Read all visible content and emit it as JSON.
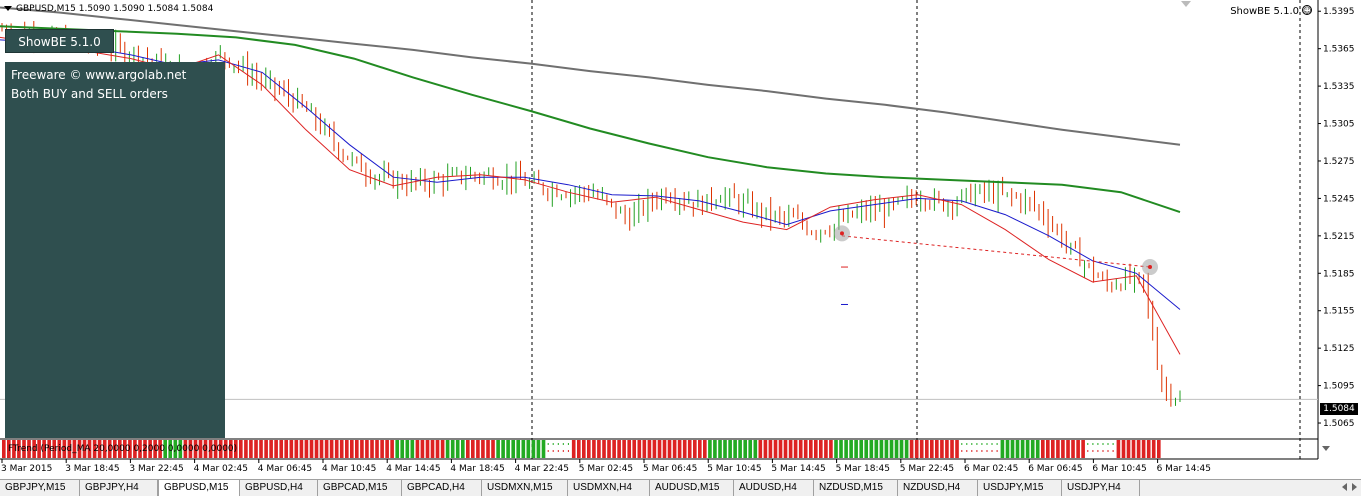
{
  "window": {
    "symbol_line": "GBPUSD,M15  1.5090 1.5090 1.5084 1.5084",
    "showbe_right": "ShowBE 5.1.0",
    "smiley_glyph": "☺",
    "current_price": "1.5084"
  },
  "showbe": {
    "button_label": "ShowBE 5.1.0",
    "freeware": "Freeware © www.argolab.net",
    "orders": "Both BUY and SELL orders"
  },
  "indicator": {
    "label": "FTrend (Period_MA 20,0000 0,2000 0,0000 0,0000)"
  },
  "chart_data": {
    "type": "candlestick",
    "symbol": "GBPUSD",
    "timeframe": "M15",
    "y_ticks": [
      "1.5395",
      "1.5365",
      "1.5335",
      "1.5305",
      "1.5275",
      "1.5245",
      "1.5215",
      "1.5185",
      "1.5155",
      "1.5125",
      "1.5095",
      "1.5065"
    ],
    "ylim": [
      1.5053,
      1.5404
    ],
    "x_ticks": [
      "3 Mar 2015",
      "3 Mar 18:45",
      "3 Mar 22:45",
      "4 Mar 02:45",
      "4 Mar 06:45",
      "4 Mar 10:45",
      "4 Mar 14:45",
      "4 Mar 18:45",
      "4 Mar 22:45",
      "5 Mar 02:45",
      "5 Mar 06:45",
      "5 Mar 10:45",
      "5 Mar 14:45",
      "5 Mar 18:45",
      "5 Mar 22:45",
      "6 Mar 02:45",
      "6 Mar 06:45",
      "6 Mar 10:45",
      "6 Mar 14:45"
    ],
    "session_separators": [
      "4 Mar 2015",
      "5 Mar 2015",
      "6 Mar 2015"
    ],
    "close_profile": [
      1.538,
      1.5378,
      1.5376,
      1.5372,
      1.537,
      1.5368,
      1.5366,
      1.5362,
      1.5356,
      1.535,
      1.5347,
      1.5352,
      1.536,
      1.535,
      1.534,
      1.5332,
      1.5322,
      1.5308,
      1.529,
      1.5275,
      1.5265,
      1.526,
      1.5257,
      1.5258,
      1.526,
      1.5263,
      1.5264,
      1.5262,
      1.526,
      1.5255,
      1.5252,
      1.525,
      1.525,
      1.524,
      1.5228,
      1.524,
      1.525,
      1.5245,
      1.524,
      1.5248,
      1.5242,
      1.5235,
      1.523,
      1.5228,
      1.522,
      1.5222,
      1.523,
      1.5235,
      1.5236,
      1.5242,
      1.5248,
      1.524,
      1.5245,
      1.525,
      1.5248,
      1.5246,
      1.524,
      1.5225,
      1.5205,
      1.519,
      1.5175,
      1.518,
      1.5178,
      1.5095,
      1.5084
    ],
    "series": [
      {
        "name": "MA slow",
        "color": "#707070",
        "values": [
          1.5398,
          1.5394,
          1.5389,
          1.5384,
          1.5379,
          1.5374,
          1.5369,
          1.5364,
          1.5358,
          1.5353,
          1.5347,
          1.5342,
          1.5336,
          1.5331,
          1.5325,
          1.532,
          1.5314,
          1.5307,
          1.53,
          1.5294,
          1.5288
        ]
      },
      {
        "name": "MA mid",
        "color": "#228b22",
        "values": [
          1.5383,
          1.5381,
          1.5379,
          1.5377,
          1.5374,
          1.5368,
          1.5357,
          1.5342,
          1.5328,
          1.5315,
          1.5301,
          1.5289,
          1.5278,
          1.527,
          1.5265,
          1.5262,
          1.526,
          1.5258,
          1.5256,
          1.525,
          1.5234
        ]
      },
      {
        "name": "MA fast",
        "color": "#1a1acc",
        "values": [
          1.5372,
          1.537,
          1.5366,
          1.536,
          1.5352,
          1.5356,
          1.5346,
          1.5318,
          1.5288,
          1.5262,
          1.5258,
          1.5262,
          1.5262,
          1.5256,
          1.5248,
          1.5247,
          1.5243,
          1.5234,
          1.5224,
          1.5235,
          1.524,
          1.5245,
          1.5243,
          1.5232,
          1.5215,
          1.5195,
          1.5185,
          1.5156
        ]
      },
      {
        "name": "MA signal",
        "color": "#dd2222",
        "values": [
          1.5374,
          1.5369,
          1.5363,
          1.5357,
          1.5348,
          1.536,
          1.5336,
          1.53,
          1.5268,
          1.5255,
          1.5262,
          1.5264,
          1.526,
          1.525,
          1.5242,
          1.5246,
          1.5236,
          1.5226,
          1.522,
          1.5238,
          1.5244,
          1.5248,
          1.524,
          1.522,
          1.5196,
          1.5178,
          1.5183,
          1.512
        ]
      }
    ],
    "ftrend_colors": {
      "down": "#dd2222",
      "up": "#22aa22",
      "neutral": "#ffffff"
    }
  },
  "tabs": [
    {
      "label": "GBPJPY,M15",
      "active": false
    },
    {
      "label": "GBPJPY,H4",
      "active": false
    },
    {
      "label": "GBPUSD,M15",
      "active": true
    },
    {
      "label": "GBPUSD,H4",
      "active": false
    },
    {
      "label": "GBPCAD,M15",
      "active": false
    },
    {
      "label": "GBPCAD,H4",
      "active": false
    },
    {
      "label": "USDMXN,M15",
      "active": false
    },
    {
      "label": "USDMXN,H4",
      "active": false
    },
    {
      "label": "AUDUSD,M15",
      "active": false
    },
    {
      "label": "AUDUSD,H4",
      "active": false
    },
    {
      "label": "NZDUSD,M15",
      "active": false
    },
    {
      "label": "NZDUSD,H4",
      "active": false
    },
    {
      "label": "USDJPY,M15",
      "active": false
    },
    {
      "label": "USDJPY,H4",
      "active": false
    }
  ]
}
